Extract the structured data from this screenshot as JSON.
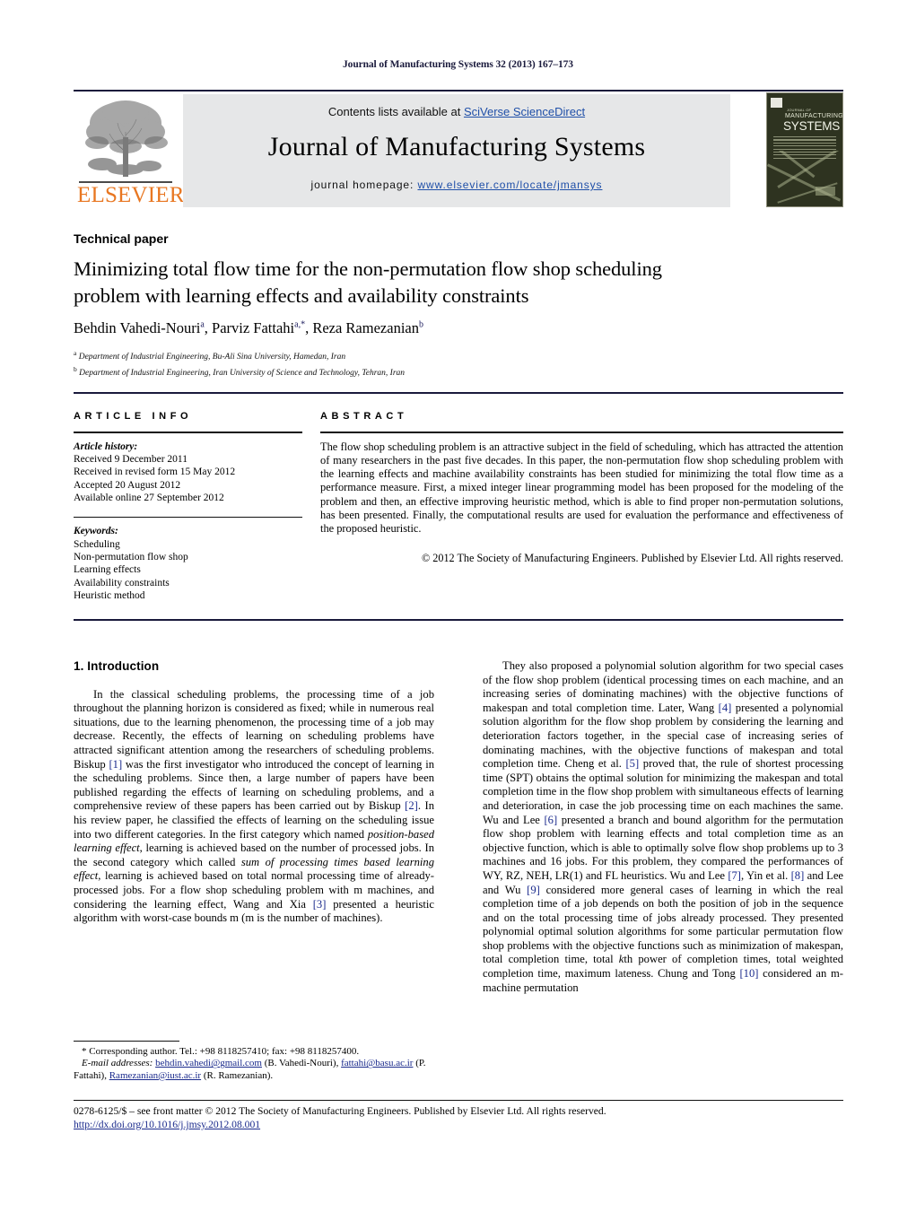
{
  "running_head": "Journal of Manufacturing Systems 32 (2013) 167–173",
  "masthead": {
    "contents_prefix": "Contents lists available at ",
    "sciencedirect": "SciVerse ScienceDirect",
    "journal_name": "Journal of Manufacturing Systems",
    "homepage_prefix": "journal homepage: ",
    "homepage_url": "www.elsevier.com/locate/jmansys",
    "publisher": "ELSEVIER",
    "cover": {
      "line1": "JOURNAL OF",
      "line2": "MANUFACTURING",
      "line3": "SYSTEMS"
    }
  },
  "article": {
    "type": "Technical paper",
    "title": "Minimizing total flow time for the non-permutation flow shop scheduling problem with learning effects and availability constraints",
    "authors_html": "Behdin Vahedi-Nouri<sup>a</sup>, Parviz Fattahi<sup>a,*</sup>, Reza Ramezanian<sup>b</sup>",
    "affiliation_a": "Department of Industrial Engineering, Bu-Ali Sina University, Hamedan, Iran",
    "affiliation_b": "Department of Industrial Engineering, Iran University of Science and Technology, Tehran, Iran"
  },
  "info": {
    "heading": "ARTICLE INFO",
    "history_label": "Article history:",
    "history": [
      "Received 9 December 2011",
      "Received in revised form 15 May 2012",
      "Accepted 20 August 2012",
      "Available online 27 September 2012"
    ],
    "keywords_label": "Keywords:",
    "keywords": [
      "Scheduling",
      "Non-permutation flow shop",
      "Learning effects",
      "Availability constraints",
      "Heuristic method"
    ]
  },
  "abstract": {
    "heading": "ABSTRACT",
    "text": "The flow shop scheduling problem is an attractive subject in the field of scheduling, which has attracted the attention of many researchers in the past five decades. In this paper, the non-permutation flow shop scheduling problem with the learning effects and machine availability constraints has been studied for minimizing the total flow time as a performance measure. First, a mixed integer linear programming model has been proposed for the modeling of the problem and then, an effective improving heuristic method, which is able to find proper non-permutation solutions, has been presented. Finally, the computational results are used for evaluation the performance and effectiveness of the proposed heuristic.",
    "copyright": "© 2012 The Society of Manufacturing Engineers. Published by Elsevier Ltd. All rights reserved."
  },
  "body": {
    "section_heading": "1. Introduction",
    "left_paragraph_html": "In the classical scheduling problems, the processing time of a job throughout the planning horizon is considered as fixed; while in numerous real situations, due to the learning phenomenon, the processing time of a job may decrease. Recently, the effects of learning on scheduling problems have attracted significant attention among the researchers of scheduling problems. Biskup <span class=\"ref\">[1]</span> was the first investigator who introduced the concept of learning in the scheduling problems. Since then, a large number of papers have been published regarding the effects of learning on scheduling problems, and a comprehensive review of these papers has been carried out by Biskup <span class=\"ref\">[2]</span>. In his review paper, he classified the effects of learning on the scheduling issue into two different categories. In the first category which named <span class=\"it\">position-based learning effect</span>, learning is achieved based on the number of processed jobs. In the second category which called <span class=\"it\">sum of processing times based learning effect</span>, learning is achieved based on total normal processing time of already-processed jobs. For a flow shop scheduling problem with m machines, and considering the learning effect, Wang and Xia <span class=\"ref\">[3]</span> presented a heuristic algorithm with worst-case bounds m (m is the number of machines).",
    "right_paragraph_html": "They also proposed a polynomial solution algorithm for two special cases of the flow shop problem (identical processing times on each machine, and an increasing series of dominating machines) with the objective functions of makespan and total completion time. Later, Wang <span class=\"ref\">[4]</span> presented a polynomial solution algorithm for the flow shop problem by considering the learning and deterioration factors together, in the special case of increasing series of dominating machines, with the objective functions of makespan and total completion time. Cheng et al. <span class=\"ref\">[5]</span> proved that, the rule of shortest processing time (SPT) obtains the optimal solution for minimizing the makespan and total completion time in the flow shop problem with simultaneous effects of learning and deterioration, in case the job processing time on each machines the same. Wu and Lee <span class=\"ref\">[6]</span> presented a branch and bound algorithm for the permutation flow shop problem with learning effects and total completion time as an objective function, which is able to optimally solve flow shop problems up to 3 machines and 16 jobs. For this problem, they compared the performances of WY, RZ, NEH, LR(1) and FL heuristics. Wu and Lee <span class=\"ref\">[7]</span>, Yin et al. <span class=\"ref\">[8]</span> and Lee and Wu <span class=\"ref\">[9]</span> considered more general cases of learning in which the real completion time of a job depends on both the position of job in the sequence and on the total processing time of jobs already processed. They presented polynomial optimal solution algorithms for some particular permutation flow shop problems with the objective functions such as minimization of makespan, total completion time, total <span class=\"it\">k</span>th power of completion times, total weighted completion time, maximum lateness. Chung and Tong <span class=\"ref\">[10]</span> considered an m-machine permutation"
  },
  "footnote": {
    "corresponding": "* Corresponding author. Tel.: +98 8118257410; fax: +98 8118257400.",
    "email_label": "E-mail addresses:",
    "email1": "behdin.vahedi@gmail.com",
    "email1_name": "(B. Vahedi-Nouri),",
    "email2": "fattahi@basu.ac.ir",
    "email2_name": "(P. Fattahi),",
    "email3": "Ramezanian@iust.ac.ir",
    "email3_name": "(R. Ramezanian)."
  },
  "page_footer": {
    "copyright_line": "0278-6125/$ – see front matter © 2012 The Society of Manufacturing Engineers. Published by Elsevier Ltd. All rights reserved.",
    "doi": "http://dx.doi.org/10.1016/j.jmsy.2012.08.001"
  }
}
